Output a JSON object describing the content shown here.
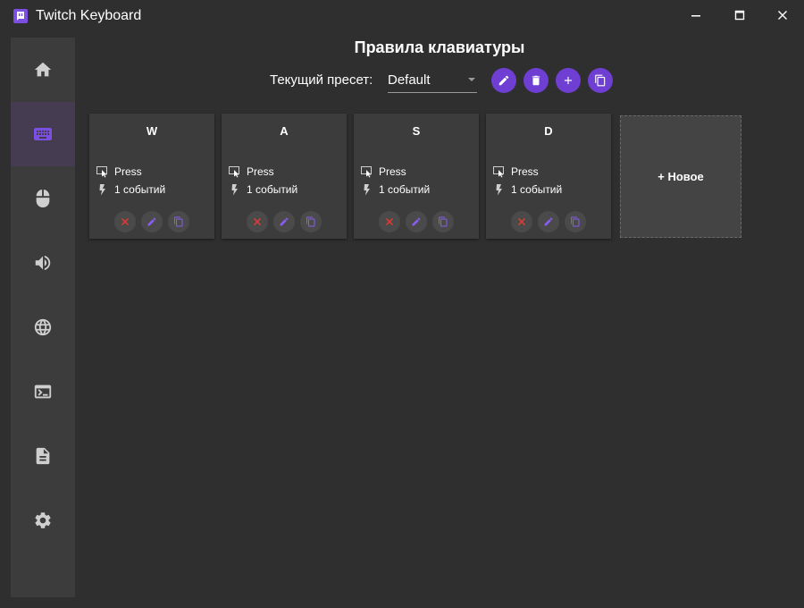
{
  "app": {
    "title": "Twitch Keyboard"
  },
  "colors": {
    "accent": "#6f3fd3",
    "background": "#2f2f2f",
    "sidebar": "#3c3c3c",
    "card": "#3c3c3c",
    "delete": "#e53935"
  },
  "sidebar": {
    "items": [
      {
        "icon": "home-icon"
      },
      {
        "icon": "keyboard-icon",
        "active": true
      },
      {
        "icon": "mouse-icon"
      },
      {
        "icon": "volume-icon"
      },
      {
        "icon": "globe-icon"
      },
      {
        "icon": "terminal-icon"
      },
      {
        "icon": "document-icon"
      },
      {
        "icon": "gear-icon"
      }
    ]
  },
  "header": {
    "title": "Правила клавиатуры",
    "preset_label": "Текущий пресет:",
    "preset_value": "Default"
  },
  "cards": [
    {
      "key": "W",
      "action": "Press",
      "events": "1 событий"
    },
    {
      "key": "A",
      "action": "Press",
      "events": "1 событий"
    },
    {
      "key": "S",
      "action": "Press",
      "events": "1 событий"
    },
    {
      "key": "D",
      "action": "Press",
      "events": "1 событий"
    }
  ],
  "new_card": {
    "label": "+ Новое"
  }
}
